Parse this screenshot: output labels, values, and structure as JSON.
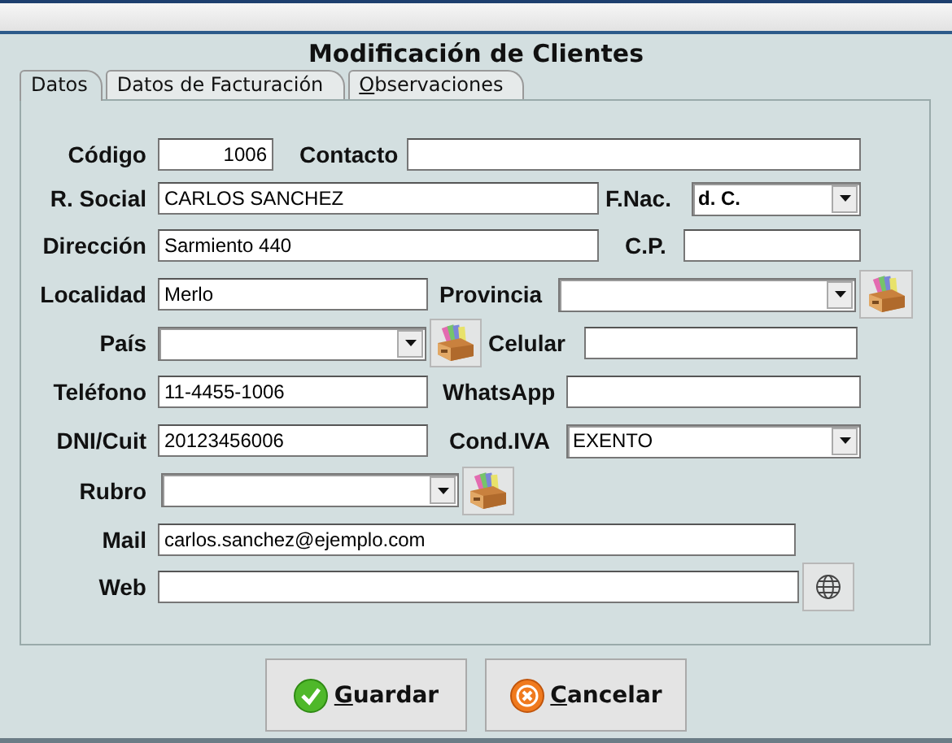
{
  "window": {
    "title": "Modificación de Clientes"
  },
  "tabs": [
    {
      "label": "Datos",
      "selected": true,
      "underline_first": false
    },
    {
      "label": "Datos de Facturación",
      "selected": false,
      "underline_first": false
    },
    {
      "label": "Observaciones",
      "selected": false,
      "underline_first": true
    }
  ],
  "rows": [
    {
      "items": [
        {
          "kind": "label",
          "text": "Código"
        },
        {
          "kind": "field",
          "value": "1006",
          "right_aligned": true
        },
        {
          "kind": "label",
          "text": "Contacto"
        },
        {
          "kind": "field",
          "value": ""
        }
      ]
    },
    {
      "items": [
        {
          "kind": "label",
          "text": "R. Social"
        },
        {
          "kind": "field",
          "value": "CARLOS SANCHEZ"
        },
        {
          "kind": "label",
          "text": "F.Nac."
        },
        {
          "kind": "combo",
          "value": "d. C.",
          "bold": true
        }
      ]
    },
    {
      "items": [
        {
          "kind": "label",
          "text": "Dirección"
        },
        {
          "kind": "field",
          "value": "Sarmiento 440"
        },
        {
          "kind": "label",
          "text": "C.P."
        },
        {
          "kind": "field",
          "value": ""
        }
      ]
    },
    {
      "items": [
        {
          "kind": "label",
          "text": "Localidad"
        },
        {
          "kind": "field",
          "value": "Merlo"
        },
        {
          "kind": "label",
          "text": "Provincia"
        },
        {
          "kind": "combo",
          "value": ""
        },
        {
          "kind": "lookup"
        }
      ]
    },
    {
      "items": [
        {
          "kind": "label",
          "text": "País"
        },
        {
          "kind": "combo",
          "value": ""
        },
        {
          "kind": "lookup"
        },
        {
          "kind": "label",
          "text": "Celular"
        },
        {
          "kind": "field",
          "value": ""
        }
      ]
    },
    {
      "items": [
        {
          "kind": "label",
          "text": "Teléfono"
        },
        {
          "kind": "field",
          "value": "11-4455-1006"
        },
        {
          "kind": "label",
          "text": "WhatsApp"
        },
        {
          "kind": "field",
          "value": ""
        }
      ]
    },
    {
      "items": [
        {
          "kind": "label",
          "text": "DNI/Cuit"
        },
        {
          "kind": "field",
          "value": "20123456006"
        },
        {
          "kind": "label",
          "text": "Cond.IVA"
        },
        {
          "kind": "combo",
          "value": "EXENTO"
        }
      ]
    },
    {
      "items": [
        {
          "kind": "label",
          "text": "Rubro"
        },
        {
          "kind": "combo",
          "value": ""
        },
        {
          "kind": "lookup"
        }
      ]
    },
    {
      "items": [
        {
          "kind": "label",
          "text": "Mail"
        },
        {
          "kind": "field",
          "value": "carlos.sanchez@ejemplo.com"
        }
      ]
    },
    {
      "items": [
        {
          "kind": "label",
          "text": "Web"
        },
        {
          "kind": "field",
          "value": ""
        },
        {
          "kind": "web"
        }
      ]
    }
  ],
  "buttons": [
    {
      "label": "Guardar",
      "kind": "ok",
      "underline_first": true
    },
    {
      "label": "Cancelar",
      "kind": "cancel",
      "underline_first": true
    }
  ]
}
